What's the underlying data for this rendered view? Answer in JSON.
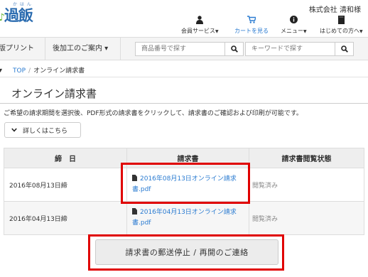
{
  "header": {
    "logo_text": "過飯",
    "logo_ruby": "か は ん",
    "company_user": "株式会社 清和様",
    "nav": [
      {
        "label": "会員サービス",
        "icon": "person-icon"
      },
      {
        "label": "カートを見る",
        "icon": "cart-icon"
      },
      {
        "label": "メニュー",
        "icon": "info-icon"
      },
      {
        "label": "はじめての方へ",
        "icon": "book-icon"
      }
    ]
  },
  "toolbar": {
    "menu1": "版プリント ▾",
    "menu2": "後加工のご案内 ▾",
    "search1_placeholder": "商品番号で探す",
    "search2_placeholder": "キーワードで探す"
  },
  "breadcrumb": {
    "home": "TOP",
    "separator": "/",
    "current": "オンライン請求書"
  },
  "page": {
    "title": "オンライン請求書",
    "description": "ご希望の請求期間を選択後、PDF形式の請求書をクリックして、請求書のご確認および印刷が可能です。",
    "detail_button": "詳しくはこちら"
  },
  "table": {
    "headers": [
      "締　日",
      "請求書",
      "請求書閲覧状態"
    ],
    "rows": [
      {
        "date": "2016年08月13日締",
        "invoice": "2016年08月13日オンライン請求書.pdf",
        "status": "閲覧済み"
      },
      {
        "date": "2016年04月13日締",
        "invoice": "2016年04月13日オンライン請求書.pdf",
        "status": "閲覧済み"
      }
    ]
  },
  "contact_button": "請求書の郵送停止 / 再開のご連絡",
  "colors": {
    "link": "#2a7bd1",
    "highlight": "#e00000"
  }
}
